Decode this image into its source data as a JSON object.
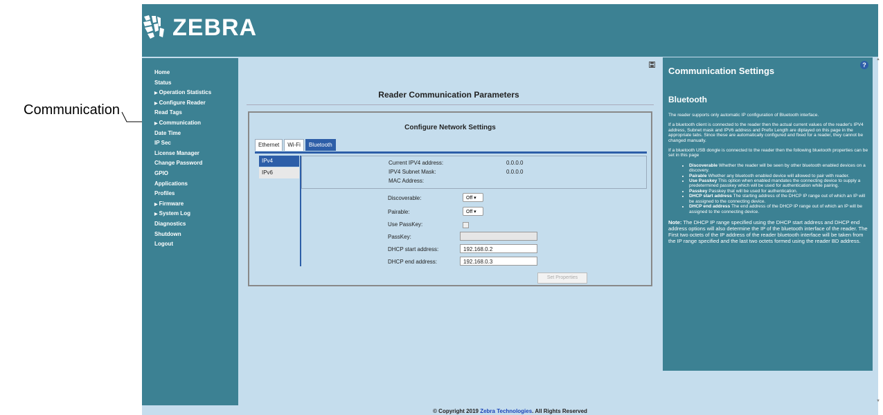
{
  "callout": {
    "label": "Communication"
  },
  "header": {
    "logo_text": "ZEBRA"
  },
  "nav": {
    "items": [
      {
        "label": "Home",
        "arrow": false
      },
      {
        "label": "Status",
        "arrow": false
      },
      {
        "label": "Operation Statistics",
        "arrow": true
      },
      {
        "label": "Configure Reader",
        "arrow": true
      },
      {
        "label": "Read Tags",
        "arrow": false
      },
      {
        "label": "Communication",
        "arrow": true
      },
      {
        "label": "Date Time",
        "arrow": false
      },
      {
        "label": "IP Sec",
        "arrow": false
      },
      {
        "label": "License Manager",
        "arrow": false
      },
      {
        "label": "Change Password",
        "arrow": false
      },
      {
        "label": "GPIO",
        "arrow": false
      },
      {
        "label": "Applications",
        "arrow": false
      },
      {
        "label": "Profiles",
        "arrow": false
      },
      {
        "label": "Firmware",
        "arrow": true
      },
      {
        "label": "System Log",
        "arrow": true
      },
      {
        "label": "Diagnostics",
        "arrow": false
      },
      {
        "label": "Shutdown",
        "arrow": false
      },
      {
        "label": "Logout",
        "arrow": false
      }
    ]
  },
  "main": {
    "title": "Reader Communication Parameters",
    "panel_title": "Configure Network Settings",
    "tabs": [
      {
        "label": "Ethernet",
        "active": false
      },
      {
        "label": "Wi-Fi",
        "active": false
      },
      {
        "label": "Bluetooth",
        "active": true
      }
    ],
    "subtabs": [
      {
        "label": "IPv4",
        "active": true
      },
      {
        "label": "IPv6",
        "active": false
      }
    ],
    "info": {
      "ipv4_label": "Current IPV4 address:",
      "ipv4_value": "0.0.0.0",
      "mask_label": "IPV4 Subnet Mask:",
      "mask_value": "0.0.0.0",
      "mac_label": "MAC Address:",
      "mac_value": ""
    },
    "form": {
      "discoverable_label": "Discoverable:",
      "discoverable_value": "Off",
      "pairable_label": "Pairable:",
      "pairable_value": "Off",
      "use_passkey_label": "Use PassKey:",
      "passkey_label": "PassKey:",
      "passkey_value": "",
      "dhcp_start_label": "DHCP start address:",
      "dhcp_start_value": "192.168.0.2",
      "dhcp_end_label": "DHCP end address:",
      "dhcp_end_value": "192.168.0.3"
    },
    "set_button": "Set Properties"
  },
  "help": {
    "icon": "?",
    "title": "Communication Settings",
    "subtitle": "Bluetooth",
    "p1": "The reader supports only automatic IP configuration of Bluetooth interface.",
    "p2": "If a bluetooth client is connected to the reader then the actual current values of the reader's IPV4 address, Subnet mask and IPV6 address and Prefix Length are diplayed on this page in the appropriate tabs. Since these are automatically configured and fixed for a reader, they cannot be changed manually.",
    "p3": "If a bluetooth USB dongle is connected to the reader then the following bluetooth properties can be set in this page",
    "bullets": [
      {
        "term": "Discoverable",
        "text": " Whether the reader will be seen by other bluetooth enabled devices on a discovery."
      },
      {
        "term": "Pairable",
        "text": " Whether any bluetooth enabled device will allowed to pair with reader."
      },
      {
        "term": "Use Passkey",
        "text": " This option when enabled mandates the connecting device to supply a predetermined passkey which will be used for authentication while pairing."
      },
      {
        "term": "Passkey",
        "text": " Passkey that will be used for authentication."
      },
      {
        "term": "DHCP start address",
        "text": " The starting address of the DHCP IP range out of which an IP will be assigned to the connecting device."
      },
      {
        "term": "DHCP end address",
        "text": " The end address of the DHCP IP range out of which an IP will be assigned to the connecting device."
      }
    ],
    "note_term": "Note:",
    "note_text": " The DHCP IP range specified using the DHCP start address and DHCP end address options will also determine the IP of the bluetooth interface of the reader. The First two octets of the IP address of the reader bluetooth interface will be taken from the IP range specified and the last two octets formed using the reader BD address."
  },
  "footer": {
    "prefix": "© Copyright 2019 ",
    "link": "Zebra Technologies",
    "suffix": ". All Rights Reserved"
  },
  "colors": {
    "header_bg": "#3c8193",
    "content_bg": "#c5dded",
    "accent_blue": "#2d5ea8"
  }
}
